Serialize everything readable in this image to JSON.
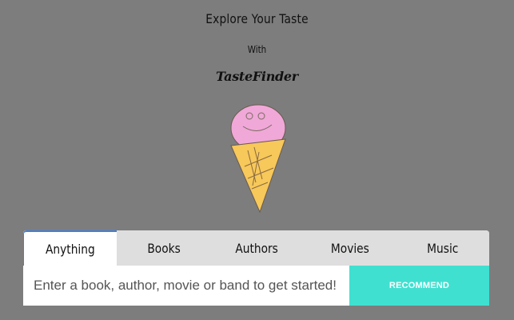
{
  "hero": {
    "title": "Explore Your Taste",
    "with": "With",
    "brand": "TasteFinder"
  },
  "tabs": [
    {
      "label": "Anything",
      "active": true
    },
    {
      "label": "Books",
      "active": false
    },
    {
      "label": "Authors",
      "active": false
    },
    {
      "label": "Movies",
      "active": false
    },
    {
      "label": "Music",
      "active": false
    }
  ],
  "search": {
    "placeholder": "Enter a book, author, movie or band to get started!",
    "value": "",
    "button_label": "RECOMMEND"
  },
  "colors": {
    "background": "#7d7d7d",
    "accent_button": "#40e0d0",
    "active_tab_border": "#3f7fe0",
    "ice_cream": "#f0a8d8",
    "cone": "#f7c85a"
  }
}
